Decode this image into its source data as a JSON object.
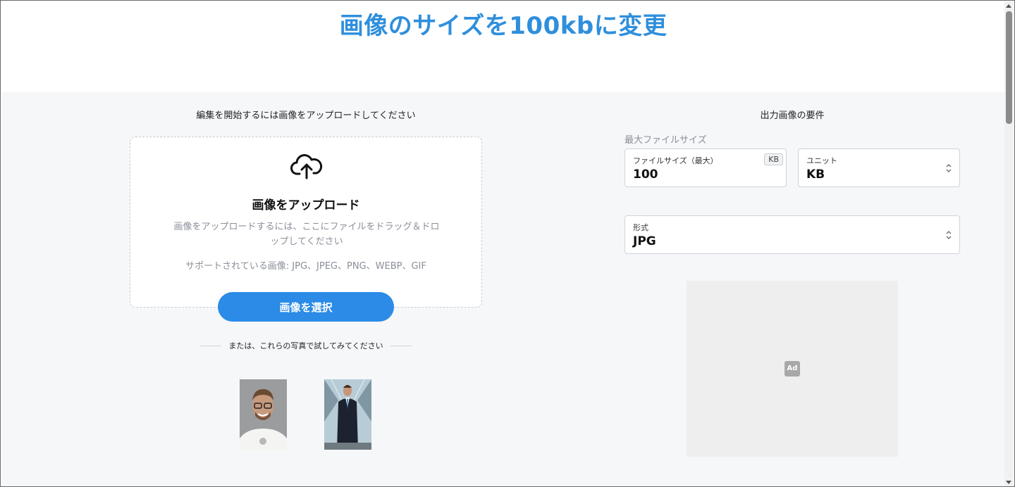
{
  "page": {
    "title": "画像のサイズを100kbに変更"
  },
  "upload": {
    "heading": "編集を開始するには画像をアップロードしてください",
    "title": "画像をアップロード",
    "description": "画像をアップロードするには、ここにファイルをドラッグ＆ドロップしてください",
    "supported": "サポートされている画像: JPG、JPEG、PNG、WEBP、GIF",
    "select_button": "画像を選択",
    "or_text": "または、これらの写真で試してみてください",
    "icon": "cloud-upload-icon"
  },
  "requirements": {
    "heading": "出力画像の要件",
    "max_size_label": "最大ファイルサイズ",
    "size_field": {
      "label": "ファイルサイズ（最大）",
      "value": "100",
      "badge": "KB"
    },
    "unit_field": {
      "label": "ユニット",
      "value": "KB"
    },
    "format_field": {
      "label": "形式",
      "value": "JPG"
    }
  },
  "ad": {
    "badge": "Ad"
  },
  "colors": {
    "title": "#2f8fdc",
    "button": "#2b8be6",
    "background": "#f6f7f9"
  }
}
